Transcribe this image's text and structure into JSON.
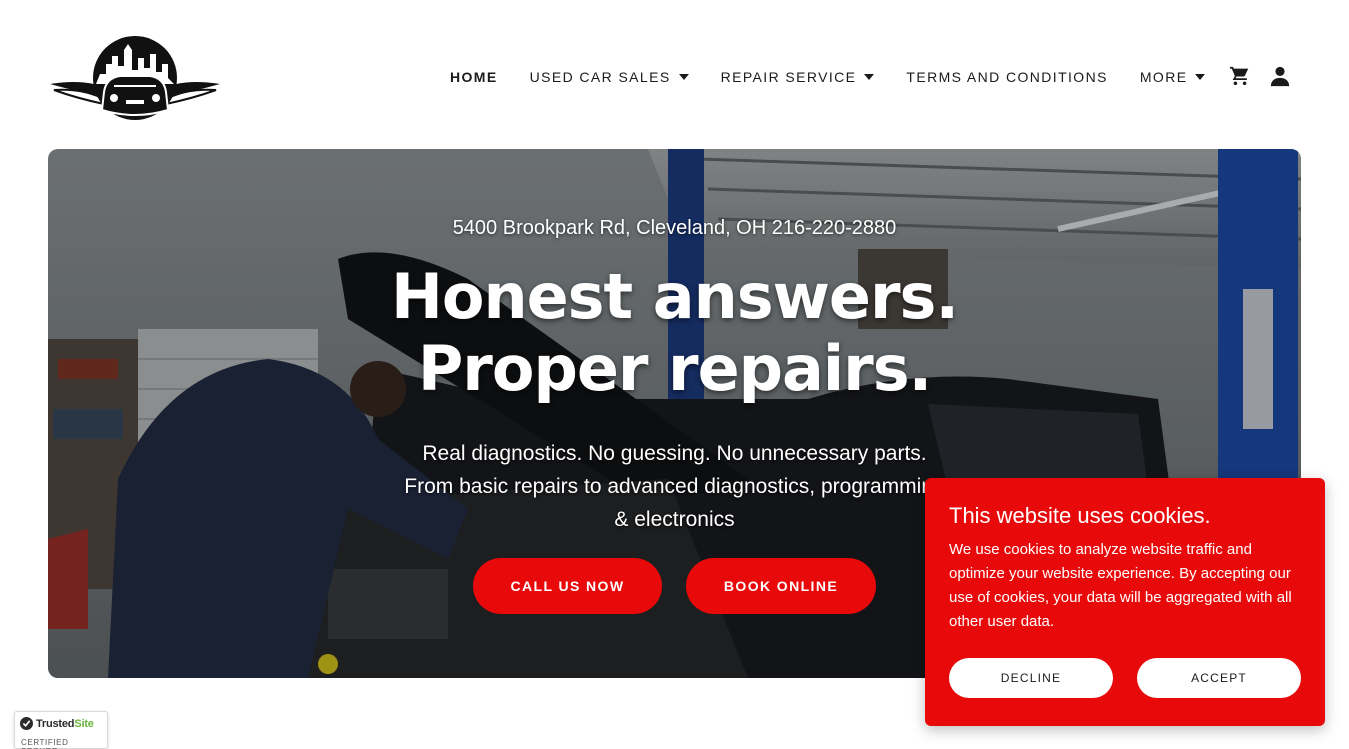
{
  "nav": {
    "items": [
      {
        "label": "HOME",
        "has_caret": false,
        "active": true
      },
      {
        "label": "USED CAR SALES",
        "has_caret": true,
        "active": false
      },
      {
        "label": "REPAIR SERVICE",
        "has_caret": true,
        "active": false
      },
      {
        "label": "TERMS AND CONDITIONS",
        "has_caret": false,
        "active": false
      },
      {
        "label": "MORE",
        "has_caret": true,
        "active": false
      }
    ],
    "icons": [
      "cart-icon",
      "account-icon"
    ]
  },
  "hero": {
    "address": "5400 Brookpark Rd, Cleveland, OH 216-220-2880",
    "headline_line1": "Honest answers.",
    "headline_line2": "Proper repairs.",
    "sub_line1": "Real diagnostics. No guessing. No unnecessary parts.",
    "sub_line2": "From basic repairs to advanced diagnostics, programming",
    "sub_line3": "& electronics",
    "call_label": "CALL US NOW",
    "book_label": "BOOK ONLINE"
  },
  "cookie": {
    "title": "This website uses cookies.",
    "text": "We use cookies to analyze website traffic and optimize your website experience. By accepting our use of cookies, your data will be aggregated with all other user data.",
    "decline_label": "DECLINE",
    "accept_label": "ACCEPT"
  },
  "badge": {
    "name_main": "Trusted",
    "name_accent": "Site",
    "sub": "CERTIFIED SECURE"
  },
  "colors": {
    "accent": "#e8090a",
    "text": "#1b1b1b",
    "badge_accent": "#6cb33f"
  }
}
